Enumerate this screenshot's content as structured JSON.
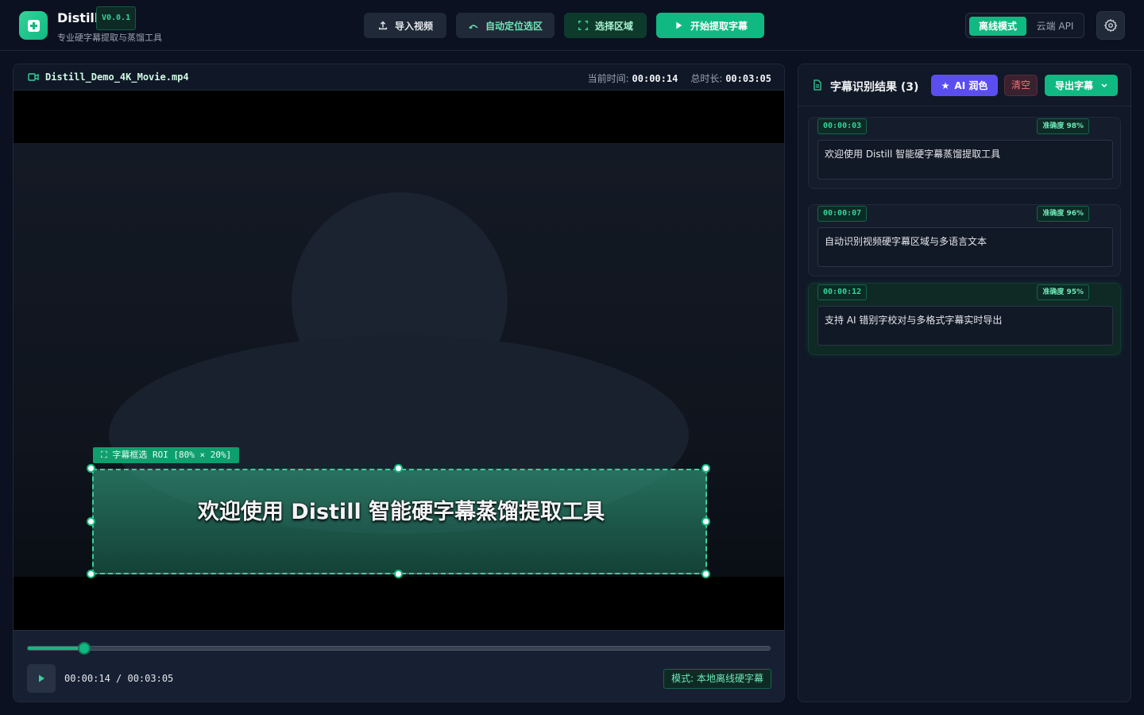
{
  "header": {
    "app_name": "Distill",
    "version": "V0.0.1",
    "subtitle": "专业硬字幕提取与蒸馏工具",
    "buttons": {
      "import": "导入视频",
      "auto_locate": "自动定位选区",
      "select_region": "选择区域",
      "start": "开始提取字幕"
    },
    "mode": {
      "offline": "离线模式",
      "cloud": "云端 API",
      "selected": "离线模式"
    }
  },
  "video": {
    "filename": "Distill_Demo_4K_Movie.mp4",
    "current_label": "当前时间:",
    "current_time": "00:00:14",
    "total_label": "总时长:",
    "total_time": "00:03:05",
    "roi_tag": "⛶ 字幕框选 ROI [80% × 20%]",
    "subtitle_text": "欢迎使用 Distill 智能硬字幕蒸馏提取工具",
    "progress_fraction": 0.076,
    "playback_time": "00:00:14 / 00:03:05",
    "mode_badge": "模式: 本地离线硬字幕"
  },
  "results": {
    "title": "字幕识别结果 (3)",
    "ai_button": "AI 润色",
    "clear_button": "清空",
    "export_button": "导出字幕",
    "items": [
      {
        "time": "00:00:03",
        "accuracy": "准确度 98%",
        "text": "欢迎使用 Distill 智能硬字幕蒸馏提取工具"
      },
      {
        "time": "00:00:07",
        "accuracy": "准确度 96%",
        "text": "自动识别视频硬字幕区域与多语言文本"
      },
      {
        "time": "00:00:12",
        "accuracy": "准确度 95%",
        "text": "支持 AI 错别字校对与多格式字幕实时导出"
      }
    ]
  },
  "colors": {
    "accent": "#10b981",
    "background": "#0b1120",
    "panel": "#111827",
    "ai": "#5b4ef0",
    "danger": "#f87171"
  },
  "icons": [
    "upload-icon",
    "route-icon",
    "select-region-icon",
    "play-icon",
    "gear-icon",
    "video-file-icon",
    "document-icon",
    "star-icon",
    "chevron-down-icon"
  ]
}
